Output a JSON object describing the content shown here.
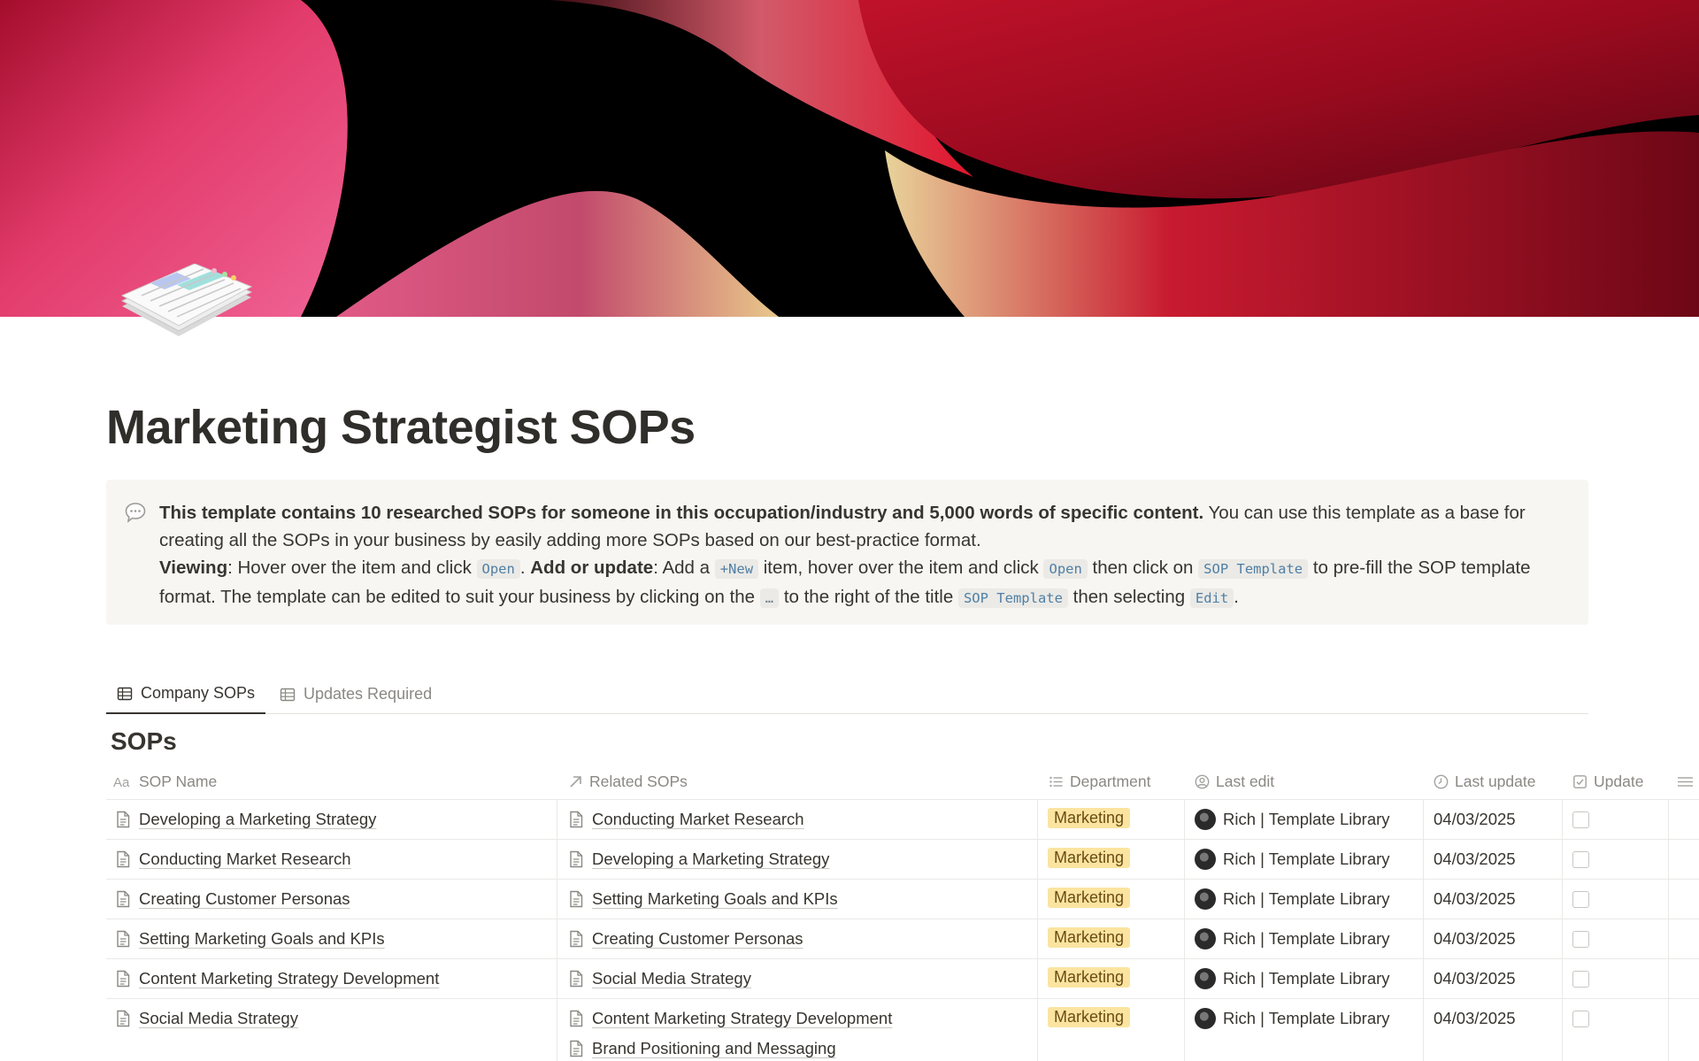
{
  "page": {
    "title": "Marketing Strategist SOPs",
    "icon": "document-stack-icon"
  },
  "callout": {
    "icon": "speech-bubble-icon",
    "bold_intro": "This template contains 10 researched SOPs for someone in this occupation/industry and 5,000 words of specific content.",
    "intro_rest": " You can use this template as a base for creating all the SOPs in your business by easily adding more SOPs based on our best-practice format.",
    "viewing_label": "Viewing",
    "viewing_text_1": ": Hover over the item and click ",
    "code_open_1": "Open",
    "viewing_text_2": ". ",
    "add_label": "Add or update",
    "add_text_1": ": Add a ",
    "code_new": "+New",
    "add_text_2": " item, hover over the item and click ",
    "code_open_2": "Open",
    "add_text_3": " then click on ",
    "code_sop_1": "SOP Template",
    "add_text_4": " to pre-fill the SOP template format. The template can be edited to suit your business by clicking on the ",
    "code_dots": "…",
    "add_text_5": " to the right of the title ",
    "code_sop_2": "SOP Template",
    "add_text_6": " then selecting ",
    "code_edit": "Edit",
    "add_text_7": "."
  },
  "tabs": [
    {
      "label": "Company SOPs",
      "icon": "table-icon",
      "active": true
    },
    {
      "label": "Updates Required",
      "icon": "table-icon",
      "active": false
    }
  ],
  "database": {
    "title": "SOPs",
    "columns": {
      "name": {
        "label": "SOP Name",
        "icon": "text-type-icon"
      },
      "related": {
        "label": "Related SOPs",
        "icon": "relation-arrow-icon"
      },
      "department": {
        "label": "Department",
        "icon": "list-icon"
      },
      "last_edit": {
        "label": "Last edit",
        "icon": "person-icon"
      },
      "last_update": {
        "label": "Last update",
        "icon": "clock-icon"
      },
      "update": {
        "label": "Update",
        "icon": "checkbox-icon"
      }
    },
    "rows": [
      {
        "name": "Developing a Marketing Strategy",
        "related": [
          "Conducting Market Research"
        ],
        "department": "Marketing",
        "last_edit": "Rich | Template Library",
        "last_update": "04/03/2025",
        "update": false
      },
      {
        "name": "Conducting Market Research",
        "related": [
          "Developing a Marketing Strategy"
        ],
        "department": "Marketing",
        "last_edit": "Rich | Template Library",
        "last_update": "04/03/2025",
        "update": false
      },
      {
        "name": "Creating Customer Personas",
        "related": [
          "Setting Marketing Goals and KPIs"
        ],
        "department": "Marketing",
        "last_edit": "Rich | Template Library",
        "last_update": "04/03/2025",
        "update": false
      },
      {
        "name": "Setting Marketing Goals and KPIs",
        "related": [
          "Creating Customer Personas"
        ],
        "department": "Marketing",
        "last_edit": "Rich | Template Library",
        "last_update": "04/03/2025",
        "update": false
      },
      {
        "name": "Content Marketing Strategy Development",
        "related": [
          "Social Media Strategy"
        ],
        "department": "Marketing",
        "last_edit": "Rich | Template Library",
        "last_update": "04/03/2025",
        "update": false
      },
      {
        "name": "Social Media Strategy",
        "related": [
          "Content Marketing Strategy Development",
          "Brand Positioning and Messaging"
        ],
        "department": "Marketing",
        "last_edit": "Rich | Template Library",
        "last_update": "04/03/2025",
        "update": false
      }
    ]
  },
  "colors": {
    "department_tag_bg": "#fbe4a0",
    "department_tag_text": "#6a4b14",
    "callout_bg": "#f7f6f3",
    "code_text": "#4f7fa6"
  }
}
